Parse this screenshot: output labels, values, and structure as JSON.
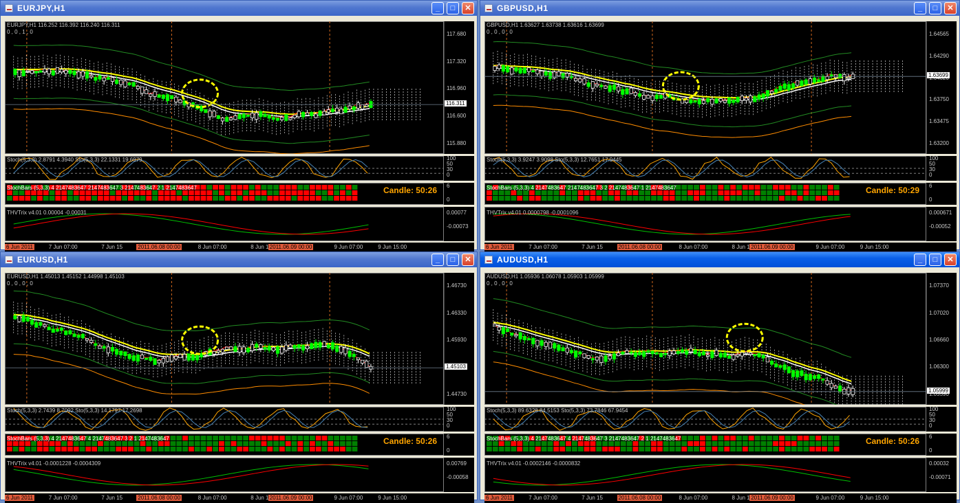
{
  "colors": {
    "bull": "#00ff00",
    "bear": "#ffffff",
    "cloud": "#ffffff",
    "ma_fast": "#ff0000",
    "ma_slow": "#ffff00",
    "ma_white": "#ffffff",
    "ma_long": "#ff8c00",
    "bands": "#228b22",
    "grid": "#d2691e",
    "stoch": "#ffa500",
    "sig": "#4682b4",
    "hi_mark": "#ffff00",
    "bar_red": "#ff0000",
    "bar_green": "#008000",
    "candle_timer": "#ffa500"
  },
  "windows": [
    {
      "title": "EURJPY,H1",
      "header": "EURJPY,H1  116.252 116.392 116.240 116.311",
      "sub": "0 , 0 , 1 , 0",
      "price_ticks": [
        "117.680",
        "117.320",
        "116.960",
        "116.600",
        "115.880"
      ],
      "price_tag": "116.311",
      "stoch": "Stoch(5,3,3) 2.8791 4.3940  Sto(5,3,3) 22.1331 19.6979",
      "stoch_ticks": [
        "100",
        "50",
        "30",
        "0"
      ],
      "stochbars": "StochBars (5,3,3) 4 2147483647 2147483647 3 2147483647 2 1 2147483647",
      "stochbar_ticks": [
        "6",
        "0"
      ],
      "candle": "Candle:  50:26",
      "trix": "THVTrix v4.01 0.00004 -0.00031",
      "trix_ticks": [
        "0.00077",
        "-0.00073"
      ],
      "time_labels": [
        "6 Jun 2011",
        "7 Jun 07:00",
        "7 Jun 15",
        "2011.06.08 00:00",
        "8 Jun 07:00",
        "8 Jun 15",
        "2011.06.09 00:00",
        "9 Jun 07:00",
        "9 Jun 15:00"
      ]
    },
    {
      "title": "GBPUSD,H1",
      "header": "GBPUSD,H1  1.63627 1.63738 1.63616 1.63699",
      "sub": "0 , 0 , 0 , 0",
      "price_ticks": [
        "1.64565",
        "1.64290",
        "1.64020",
        "1.63750",
        "1.63475",
        "1.63200"
      ],
      "price_tag": "1.63699",
      "stoch": "Stoch(5,3,3) 3.9247 3.9098  Sto(5,3,3) 12.7651 17.9445",
      "stoch_ticks": [
        "100",
        "50",
        "30",
        "0"
      ],
      "stochbars": "StochBars (5,3,3) 4 2147483647 2147483647 3 2 2147483647 1 2147483647",
      "stochbar_ticks": [
        "6",
        "0"
      ],
      "candle": "Candle:  50:29",
      "trix": "THVTrix v4.01 0.0000798 -0.0001096",
      "trix_ticks": [
        "0.000671",
        "-0.00052"
      ],
      "time_labels": [
        "6 Jun 2011",
        "7 Jun 07:00",
        "7 Jun 15",
        "2011.06.08 00:00",
        "8 Jun 07:00",
        "8 Jun 15",
        "2011.06.09 00:00",
        "9 Jun 07:00",
        "9 Jun 15:00"
      ]
    },
    {
      "title": "EURUSD,H1",
      "header": "EURUSD,H1  1.45013 1.45152 1.44998 1.45103",
      "sub": "0 , 0 , 0 , 0",
      "price_ticks": [
        "1.46730",
        "1.46330",
        "1.45930",
        "1.45530",
        "1.44730"
      ],
      "price_tag": "1.45103",
      "stoch": "Stoch(5,3,3) 2.7439 8.7092  Sto(5,3,3) 14.1797 17.2698",
      "stoch_ticks": [
        "100",
        "50",
        "30",
        "0"
      ],
      "stochbars": "StochBars (5,3,3) 4 2147483647 4 2147483647 3 2 1 2147483647",
      "stochbar_ticks": [
        "6",
        "0"
      ],
      "candle": "Candle:  50:26",
      "trix": "THVTrix v4.01 -0.0001228 -0.0004309",
      "trix_ticks": [
        "0.00769",
        "-0.00058"
      ],
      "time_labels": [
        "6 Jun 2011",
        "7 Jun 07:00",
        "7 Jun 15",
        "2011.06.08 00:00",
        "8 Jun 07:00",
        "8 Jun 15",
        "2011.06.09 00:00",
        "9 Jun 07:00",
        "9 Jun 15:00"
      ]
    },
    {
      "title": "AUDUSD,H1",
      "header": "AUDUSD,H1  1.05936 1.06078 1.05903 1.05999",
      "sub": "0 , 0 , 0 , 0",
      "price_ticks": [
        "1.07370",
        "1.07020",
        "1.06660",
        "1.06300",
        "1.05590"
      ],
      "price_tag": "1.05999",
      "stoch": "Stoch(5,3,3) 89.6328 84.5153  Sto(5,3,3) 73.7846 67.9454",
      "stoch_ticks": [
        "100",
        "50",
        "30",
        "0"
      ],
      "stochbars": "StochBars (5,3,3) 4 2147483647 4 2147483647 3 2147483647 2 1 2147483647",
      "stochbar_ticks": [
        "6",
        "0"
      ],
      "candle": "Candle:  50:26",
      "trix": "THVTrix v4.01 -0.0002146 -0.0000832",
      "trix_ticks": [
        "0.00032",
        "-0.00071"
      ],
      "time_labels": [
        "6 Jun 2011",
        "7 Jun 07:00",
        "7 Jun 15",
        "2011.06.08 00:00",
        "8 Jun 07:00",
        "8 Jun 15",
        "2011.06.09 00:00",
        "9 Jun 07:00",
        "9 Jun 15:00"
      ]
    }
  ]
}
